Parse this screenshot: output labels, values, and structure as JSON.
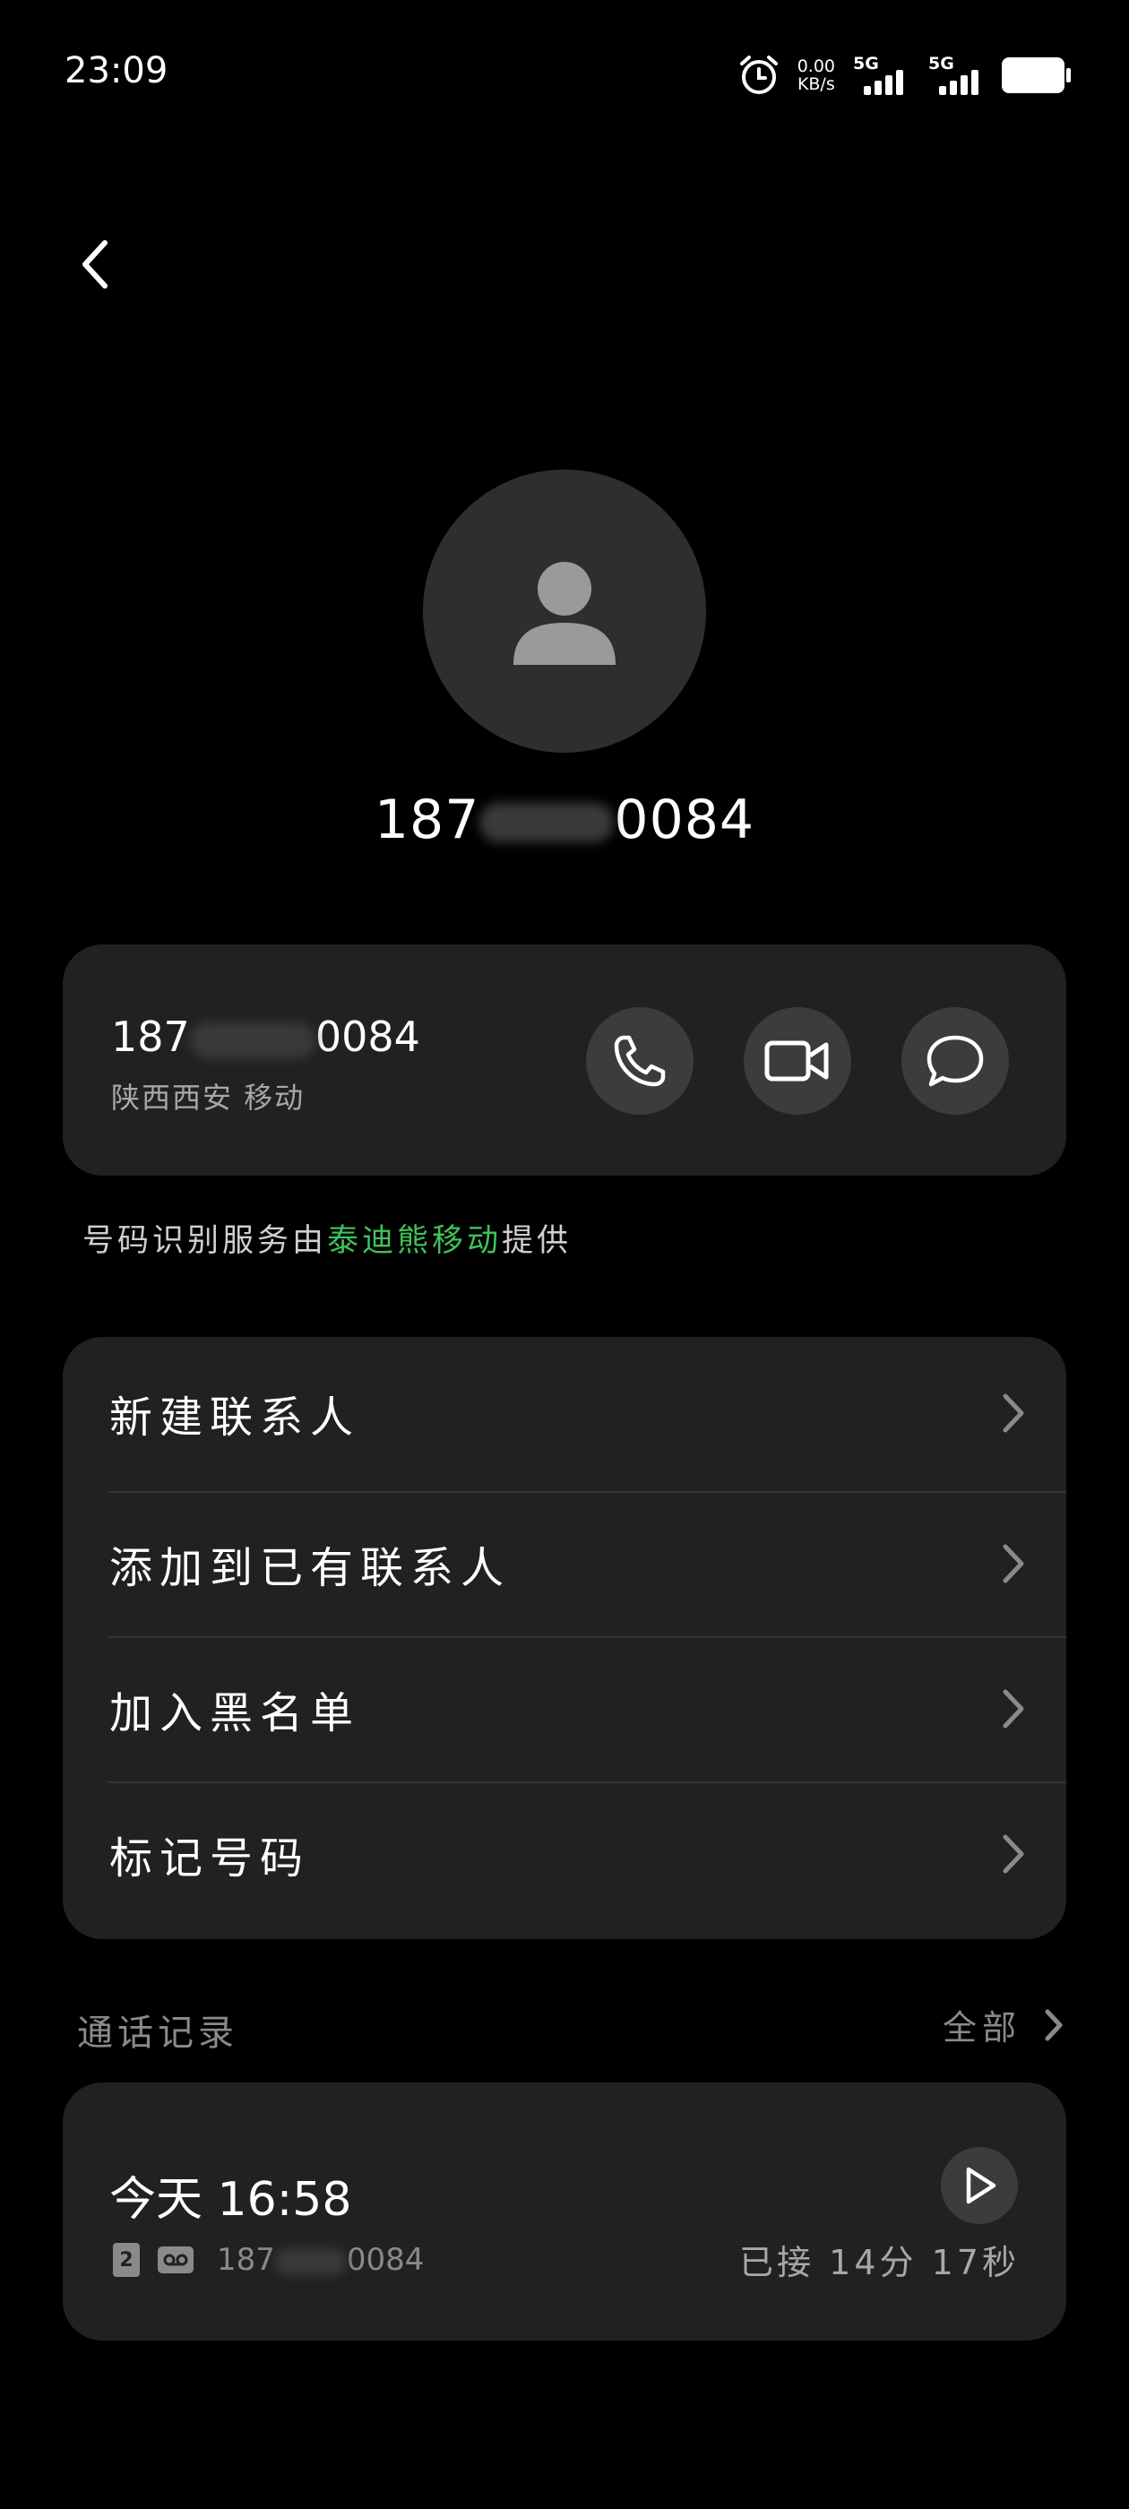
{
  "status_bar": {
    "time": "23:09",
    "net_speed_value": "0.00",
    "net_speed_unit": "KB/s",
    "signal1_label": "5G",
    "signal2_label": "5G"
  },
  "header": {
    "number": "187****0084",
    "number_prefix": "187",
    "number_suffix": "0084"
  },
  "number_card": {
    "number_prefix": "187",
    "number_suffix": "0084",
    "location": "陕西西安 移动"
  },
  "provider_note": {
    "before": "号码识别服务由",
    "highlight": "泰迪熊移动",
    "after": "提供"
  },
  "menu": {
    "items": [
      {
        "label": "新建联系人"
      },
      {
        "label": "添加到已有联系人"
      },
      {
        "label": "加入黑名单"
      },
      {
        "label": "标记号码"
      }
    ]
  },
  "call_log": {
    "title": "通话记录",
    "all_label": "全部",
    "entries": [
      {
        "day": "今天",
        "time": "16:58",
        "sim": "2",
        "number_prefix": "187",
        "number_suffix": "0084",
        "status": "已接",
        "duration_min": "14",
        "min_unit": "分",
        "duration_sec": "17",
        "sec_unit": "秒"
      }
    ]
  },
  "colors": {
    "background": "#000000",
    "card": "#212121",
    "button": "#3c3c3c",
    "highlight_green": "#3fc25a"
  },
  "icons": [
    "alarm-icon",
    "back-arrow-icon",
    "person-icon",
    "phone-icon",
    "video-icon",
    "message-icon",
    "chevron-right-icon",
    "play-icon",
    "sim-card-icon",
    "voicemail-icon"
  ]
}
